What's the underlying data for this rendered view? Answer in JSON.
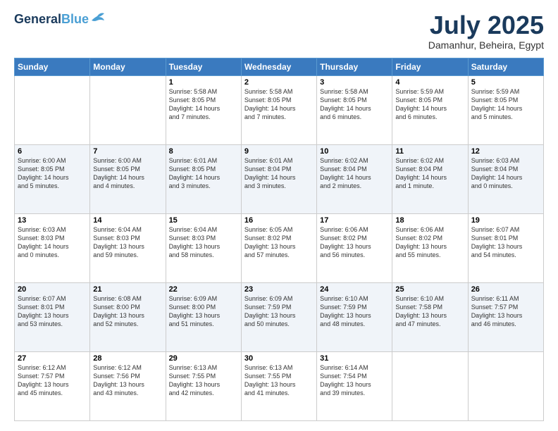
{
  "logo": {
    "line1": "General",
    "line2": "Blue"
  },
  "header": {
    "month_year": "July 2025",
    "location": "Damanhur, Beheira, Egypt"
  },
  "days_of_week": [
    "Sunday",
    "Monday",
    "Tuesday",
    "Wednesday",
    "Thursday",
    "Friday",
    "Saturday"
  ],
  "weeks": [
    [
      {
        "day": "",
        "info": ""
      },
      {
        "day": "",
        "info": ""
      },
      {
        "day": "1",
        "info": "Sunrise: 5:58 AM\nSunset: 8:05 PM\nDaylight: 14 hours\nand 7 minutes."
      },
      {
        "day": "2",
        "info": "Sunrise: 5:58 AM\nSunset: 8:05 PM\nDaylight: 14 hours\nand 7 minutes."
      },
      {
        "day": "3",
        "info": "Sunrise: 5:58 AM\nSunset: 8:05 PM\nDaylight: 14 hours\nand 6 minutes."
      },
      {
        "day": "4",
        "info": "Sunrise: 5:59 AM\nSunset: 8:05 PM\nDaylight: 14 hours\nand 6 minutes."
      },
      {
        "day": "5",
        "info": "Sunrise: 5:59 AM\nSunset: 8:05 PM\nDaylight: 14 hours\nand 5 minutes."
      }
    ],
    [
      {
        "day": "6",
        "info": "Sunrise: 6:00 AM\nSunset: 8:05 PM\nDaylight: 14 hours\nand 5 minutes."
      },
      {
        "day": "7",
        "info": "Sunrise: 6:00 AM\nSunset: 8:05 PM\nDaylight: 14 hours\nand 4 minutes."
      },
      {
        "day": "8",
        "info": "Sunrise: 6:01 AM\nSunset: 8:05 PM\nDaylight: 14 hours\nand 3 minutes."
      },
      {
        "day": "9",
        "info": "Sunrise: 6:01 AM\nSunset: 8:04 PM\nDaylight: 14 hours\nand 3 minutes."
      },
      {
        "day": "10",
        "info": "Sunrise: 6:02 AM\nSunset: 8:04 PM\nDaylight: 14 hours\nand 2 minutes."
      },
      {
        "day": "11",
        "info": "Sunrise: 6:02 AM\nSunset: 8:04 PM\nDaylight: 14 hours\nand 1 minute."
      },
      {
        "day": "12",
        "info": "Sunrise: 6:03 AM\nSunset: 8:04 PM\nDaylight: 14 hours\nand 0 minutes."
      }
    ],
    [
      {
        "day": "13",
        "info": "Sunrise: 6:03 AM\nSunset: 8:03 PM\nDaylight: 14 hours\nand 0 minutes."
      },
      {
        "day": "14",
        "info": "Sunrise: 6:04 AM\nSunset: 8:03 PM\nDaylight: 13 hours\nand 59 minutes."
      },
      {
        "day": "15",
        "info": "Sunrise: 6:04 AM\nSunset: 8:03 PM\nDaylight: 13 hours\nand 58 minutes."
      },
      {
        "day": "16",
        "info": "Sunrise: 6:05 AM\nSunset: 8:02 PM\nDaylight: 13 hours\nand 57 minutes."
      },
      {
        "day": "17",
        "info": "Sunrise: 6:06 AM\nSunset: 8:02 PM\nDaylight: 13 hours\nand 56 minutes."
      },
      {
        "day": "18",
        "info": "Sunrise: 6:06 AM\nSunset: 8:02 PM\nDaylight: 13 hours\nand 55 minutes."
      },
      {
        "day": "19",
        "info": "Sunrise: 6:07 AM\nSunset: 8:01 PM\nDaylight: 13 hours\nand 54 minutes."
      }
    ],
    [
      {
        "day": "20",
        "info": "Sunrise: 6:07 AM\nSunset: 8:01 PM\nDaylight: 13 hours\nand 53 minutes."
      },
      {
        "day": "21",
        "info": "Sunrise: 6:08 AM\nSunset: 8:00 PM\nDaylight: 13 hours\nand 52 minutes."
      },
      {
        "day": "22",
        "info": "Sunrise: 6:09 AM\nSunset: 8:00 PM\nDaylight: 13 hours\nand 51 minutes."
      },
      {
        "day": "23",
        "info": "Sunrise: 6:09 AM\nSunset: 7:59 PM\nDaylight: 13 hours\nand 50 minutes."
      },
      {
        "day": "24",
        "info": "Sunrise: 6:10 AM\nSunset: 7:59 PM\nDaylight: 13 hours\nand 48 minutes."
      },
      {
        "day": "25",
        "info": "Sunrise: 6:10 AM\nSunset: 7:58 PM\nDaylight: 13 hours\nand 47 minutes."
      },
      {
        "day": "26",
        "info": "Sunrise: 6:11 AM\nSunset: 7:57 PM\nDaylight: 13 hours\nand 46 minutes."
      }
    ],
    [
      {
        "day": "27",
        "info": "Sunrise: 6:12 AM\nSunset: 7:57 PM\nDaylight: 13 hours\nand 45 minutes."
      },
      {
        "day": "28",
        "info": "Sunrise: 6:12 AM\nSunset: 7:56 PM\nDaylight: 13 hours\nand 43 minutes."
      },
      {
        "day": "29",
        "info": "Sunrise: 6:13 AM\nSunset: 7:55 PM\nDaylight: 13 hours\nand 42 minutes."
      },
      {
        "day": "30",
        "info": "Sunrise: 6:13 AM\nSunset: 7:55 PM\nDaylight: 13 hours\nand 41 minutes."
      },
      {
        "day": "31",
        "info": "Sunrise: 6:14 AM\nSunset: 7:54 PM\nDaylight: 13 hours\nand 39 minutes."
      },
      {
        "day": "",
        "info": ""
      },
      {
        "day": "",
        "info": ""
      }
    ]
  ]
}
